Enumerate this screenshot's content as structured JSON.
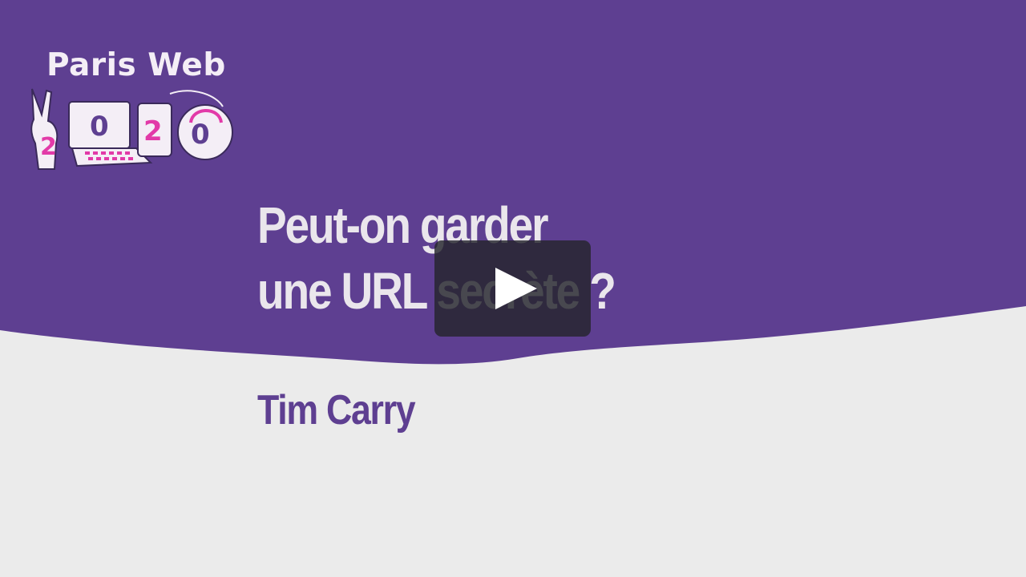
{
  "colors": {
    "top_band": "#5e3f91",
    "bottom_band": "#ebebeb",
    "title_text": "#eae6ec",
    "speaker_text": "#5e3f91",
    "logo_accent": "#e23aa8"
  },
  "logo": {
    "title": "Paris Web",
    "digits": [
      "2",
      "0",
      "2",
      "0"
    ]
  },
  "talk": {
    "title_line1": "Peut-on garder",
    "title_line2": "une URL secrète ?",
    "speaker": "Tim Carry"
  },
  "player": {
    "play_icon": "play-icon"
  }
}
